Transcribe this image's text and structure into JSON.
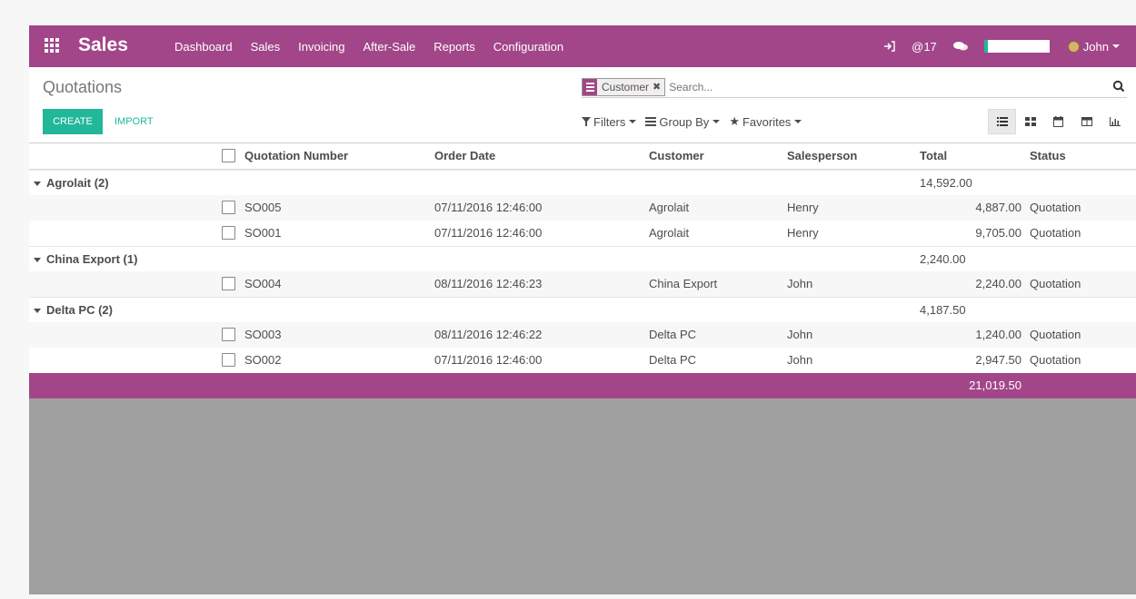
{
  "app": {
    "name": "Sales",
    "accent": "#a24689",
    "primary_button": "#21b799"
  },
  "menu": [
    "Dashboard",
    "Sales",
    "Invoicing",
    "After-Sale",
    "Reports",
    "Configuration"
  ],
  "systray": {
    "messages_count": "@17",
    "user": "John"
  },
  "page": {
    "title": "Quotations",
    "create_label": "CREATE",
    "import_label": "IMPORT"
  },
  "search": {
    "facet": "Customer",
    "placeholder": "Search..."
  },
  "filters": {
    "filters_label": "Filters",
    "groupby_label": "Group By",
    "favorites_label": "Favorites"
  },
  "columns": [
    "Quotation Number",
    "Order Date",
    "Customer",
    "Salesperson",
    "Total",
    "Status"
  ],
  "groups": [
    {
      "label": "Agrolait (2)",
      "total": "14,592.00",
      "rows": [
        {
          "number": "SO005",
          "date": "07/11/2016 12:46:00",
          "customer": "Agrolait",
          "salesperson": "Henry",
          "total": "4,887.00",
          "status": "Quotation"
        },
        {
          "number": "SO001",
          "date": "07/11/2016 12:46:00",
          "customer": "Agrolait",
          "salesperson": "Henry",
          "total": "9,705.00",
          "status": "Quotation"
        }
      ]
    },
    {
      "label": "China Export (1)",
      "total": "2,240.00",
      "rows": [
        {
          "number": "SO004",
          "date": "08/11/2016 12:46:23",
          "customer": "China Export",
          "salesperson": "John",
          "total": "2,240.00",
          "status": "Quotation"
        }
      ]
    },
    {
      "label": "Delta PC (2)",
      "total": "4,187.50",
      "rows": [
        {
          "number": "SO003",
          "date": "08/11/2016 12:46:22",
          "customer": "Delta PC",
          "salesperson": "John",
          "total": "1,240.00",
          "status": "Quotation"
        },
        {
          "number": "SO002",
          "date": "07/11/2016 12:46:00",
          "customer": "Delta PC",
          "salesperson": "John",
          "total": "2,947.50",
          "status": "Quotation"
        }
      ]
    }
  ],
  "grand_total": "21,019.50"
}
